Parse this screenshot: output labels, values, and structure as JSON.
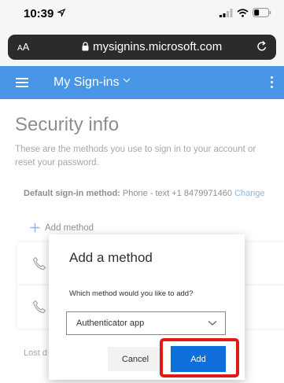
{
  "status_bar": {
    "time": "10:39",
    "icons": [
      "location-arrow-icon",
      "signal-icon",
      "wifi-icon",
      "battery-icon"
    ]
  },
  "browser": {
    "text_size_label_small": "A",
    "text_size_label_large": "A",
    "url": "mysignins.microsoft.com"
  },
  "app_header": {
    "title": "My Sign-ins",
    "color": "#4a96e6"
  },
  "page": {
    "title": "Security info",
    "description": "These are the methods you use to sign in to your account or reset your password.",
    "default_method_label": "Default sign-in method:",
    "default_method_value": " Phone - text +1 8479971460 ",
    "change_link": "Change",
    "add_method": "Add method",
    "lost_device_prefix": "Lost d"
  },
  "dialog": {
    "title": "Add a method",
    "question": "Which method would you like to add?",
    "selected_option": "Authenticator app",
    "cancel_label": "Cancel",
    "add_label": "Add",
    "add_color": "#0f6fdb",
    "highlight_color": "#e01818"
  }
}
